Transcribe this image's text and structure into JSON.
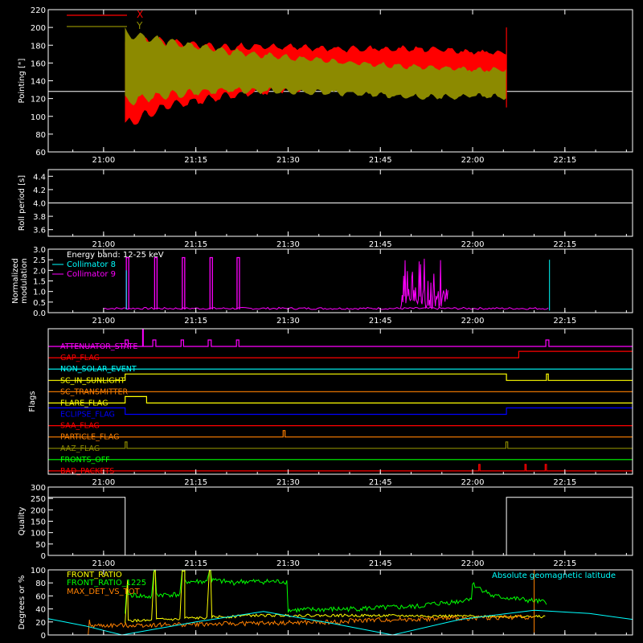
{
  "x_ticks": [
    {
      "t": 60,
      "label": "21:00"
    },
    {
      "t": 75,
      "label": "21:15"
    },
    {
      "t": 90,
      "label": "21:30"
    },
    {
      "t": 105,
      "label": "21:45"
    },
    {
      "t": 120,
      "label": "22:00"
    },
    {
      "t": 135,
      "label": "22:15"
    }
  ],
  "colors": {
    "X": "#ff0000",
    "Y": "#8c8a00",
    "white": "#ffffff",
    "cyan": "#00ffff",
    "magenta": "#ff00ff",
    "green": "#00ff00",
    "yellow": "#ffff00",
    "orange": "#ff8000",
    "blue": "#0000ff",
    "red": "#ff0000"
  },
  "chart_data": [
    {
      "type": "line",
      "ylabel": "Pointing [\"]",
      "ylim": [
        60,
        220
      ],
      "yticks": [
        60,
        80,
        100,
        120,
        140,
        160,
        180,
        200,
        220
      ],
      "xlim_minutes": [
        51,
        146
      ],
      "legend": {
        "position": "top-left",
        "entries": [
          "X",
          "Y"
        ]
      },
      "series": [
        {
          "name": "X",
          "envelope": {
            "t": [
              63.5,
              70,
              80,
              90,
              100,
              110,
              116,
              120,
              125.5
            ],
            "min": [
              82,
              105,
              118,
              126,
              130,
              136,
              138,
              140,
              140
            ],
            "max": [
              190,
              190,
              183,
              183,
              180,
              180,
              178,
              176,
              175
            ]
          }
        },
        {
          "name": "Y",
          "envelope": {
            "t": [
              63.5,
              70,
              80,
              90,
              100,
              110,
              116,
              120,
              125.5
            ],
            "min": [
              110,
              118,
              125,
              124,
              122,
              118,
              118,
              120,
              118
            ],
            "max": [
              200,
              190,
              178,
              170,
              164,
              160,
              158,
              156,
              156
            ]
          }
        }
      ],
      "reference_line": 128
    },
    {
      "type": "line",
      "ylabel": "Roll period [s]",
      "ylim": [
        3.5,
        4.5
      ],
      "yticks": [
        "3.6",
        "3.8",
        "4.0",
        "4.2",
        "4.4"
      ],
      "series": [
        {
          "value": 4.0
        }
      ]
    },
    {
      "type": "line",
      "ylabel": "Normalized modulation",
      "ylim": [
        0,
        3
      ],
      "yticks": [
        "0.0",
        "0.5",
        "1.0",
        "1.5",
        "2.0",
        "2.5",
        "3.0"
      ],
      "legend": {
        "position": "top-left",
        "entries": [
          "Energy band: 12-25 keV",
          "Collimator 8",
          "Collimator 9"
        ]
      },
      "baseline": {
        "t": [
          60,
          132.5
        ],
        "value": 0.15
      },
      "spikes_t": [
        63.7,
        68.3,
        72.8,
        77.3,
        81.7
      ],
      "spike_value": 2.6,
      "burst_t": [
        108.3,
        116
      ],
      "late_spike_t": 132.5
    },
    {
      "type": "table",
      "ylabel": "Flags",
      "flags": [
        {
          "name": "ATTENUATOR_STATE",
          "color": "#ff00ff",
          "pulses": [
            [
              63.5,
              64
            ],
            [
              68,
              68.5
            ],
            [
              72.6,
              73
            ],
            [
              77,
              77.5
            ],
            [
              81.6,
              82
            ],
            [
              131.9,
              132.4
            ]
          ]
        },
        {
          "name": "GAP_FLAG",
          "color": "#ff0000",
          "pulses": [
            [
              127.5,
              146
            ]
          ]
        },
        {
          "name": "NON_SOLAR_EVENT",
          "color": "#00ffff",
          "pulses": []
        },
        {
          "name": "SC_IN_SUNLIGHT",
          "color": "#ffff00",
          "pulses": [
            [
              63.5,
              125.5
            ],
            [
              132,
              132.3
            ]
          ]
        },
        {
          "name": "SC_TRANSMITTER",
          "color": "#ff8000",
          "pulses": []
        },
        {
          "name": "FLARE_FLAG",
          "color": "#ffff00",
          "pulses": [
            [
              63.5,
              67
            ]
          ]
        },
        {
          "name": "ECLIPSE_FLAG",
          "color": "#0000ff",
          "pulses": [
            [
              51,
              63.5
            ],
            [
              125.5,
              146
            ]
          ]
        },
        {
          "name": "SAA_FLAG",
          "color": "#ff0000",
          "pulses": []
        },
        {
          "name": "PARTICLE_FLAG",
          "color": "#ff8000",
          "pulses": [
            [
              89.2,
              89.5
            ]
          ]
        },
        {
          "name": "AAZ_FLAG",
          "color": "#8c8a00",
          "pulses": [
            [
              63.5,
              63.8
            ],
            [
              125.4,
              125.7
            ]
          ]
        },
        {
          "name": "FRONTS_OFF",
          "color": "#00ff00",
          "pulses": []
        },
        {
          "name": "BAD_PACKETS",
          "color": "#ff0000",
          "pulses": [
            [
              121,
              121.2
            ],
            [
              128.5,
              128.7
            ],
            [
              131.8,
              132
            ]
          ]
        }
      ]
    },
    {
      "type": "line",
      "ylabel": "Quality",
      "ylim": [
        0,
        300
      ],
      "yticks": [
        0,
        50,
        100,
        150,
        200,
        250,
        300
      ],
      "series": [
        {
          "points": [
            [
              51,
              255
            ],
            [
              63.5,
              255
            ],
            [
              63.5,
              0
            ],
            [
              125.5,
              0
            ],
            [
              125.5,
              255
            ],
            [
              146,
              255
            ]
          ]
        }
      ]
    },
    {
      "type": "line",
      "ylabel": "Degrees or %",
      "ylim": [
        0,
        100
      ],
      "yticks": [
        0,
        20,
        40,
        60,
        80,
        100
      ],
      "legend": {
        "position": "top-left",
        "entries": [
          "FRONT_RATIO",
          "FRONT_RATIO_1225",
          "MAX_DET_VS_TOT"
        ]
      },
      "annotation": "Absolute geomagnetic latitude",
      "series": [
        {
          "name": "FRONT_RATIO",
          "color": "#ffff00"
        },
        {
          "name": "FRONT_RATIO_1225",
          "color": "#00ff00"
        },
        {
          "name": "MAX_DET_VS_TOT",
          "color": "#ff8000"
        },
        {
          "name": "Absolute geomagnetic latitude",
          "color": "#00ffff",
          "points": [
            [
              51,
              25
            ],
            [
              57,
              14
            ],
            [
              63,
              0
            ],
            [
              75,
              20
            ],
            [
              86,
              36
            ],
            [
              97,
              18
            ],
            [
              107,
              0
            ],
            [
              118,
              24
            ],
            [
              130,
              38
            ],
            [
              139,
              33
            ],
            [
              146,
              24
            ]
          ]
        }
      ]
    }
  ]
}
